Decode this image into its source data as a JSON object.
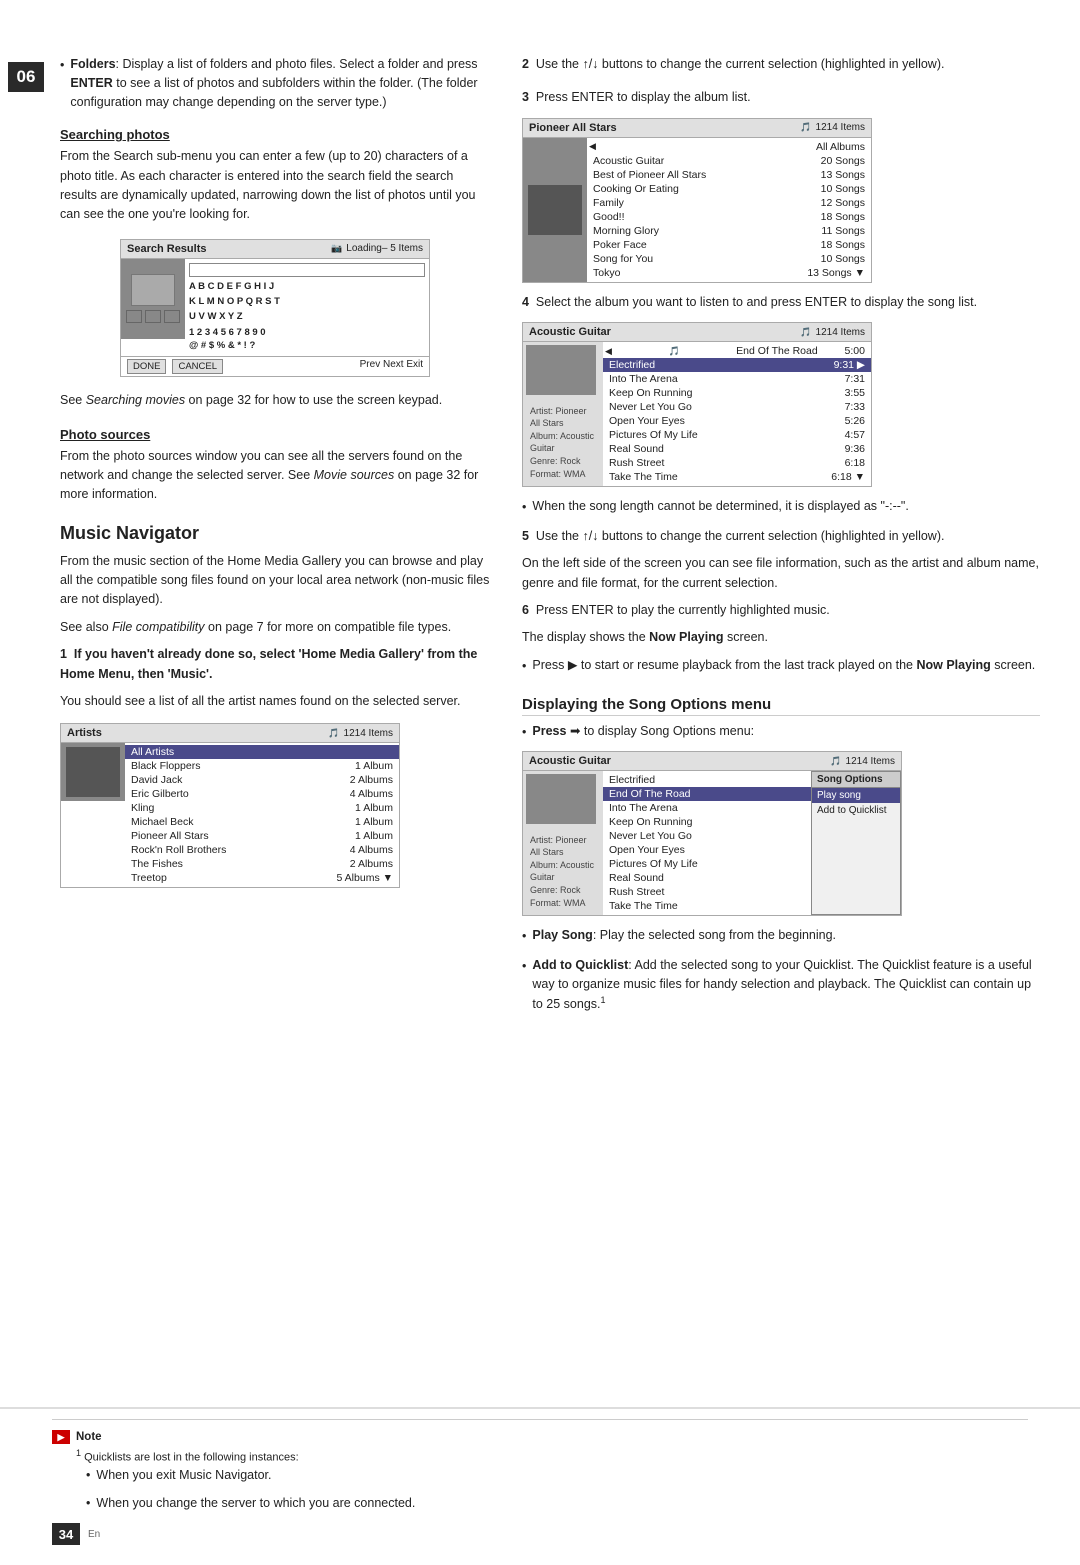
{
  "page": {
    "chapter": "06",
    "page_number": "34",
    "lang": "En"
  },
  "left_column": {
    "bullet_folders": {
      "label": "Folders",
      "text": ": Display a list of folders and photo files. Select a folder and press ",
      "enter_label": "ENTER",
      "text2": " to see a list of photos and subfolders within the folder. (The folder configuration may change depending on the server type.)"
    },
    "searching_photos": {
      "heading": "Searching photos",
      "body": "From the Search sub-menu you can enter a few (up to 20) characters of a photo title. As each character is entered into the search field the search results are dynamically updated, narrowing down the list of photos until you can see the one you're looking for."
    },
    "search_screenshot": {
      "header": "Search Results",
      "badge": "Loading– 5 Items",
      "keypad_row1": "A B C D E F G H I J",
      "keypad_row2": "K L M N O P Q R S T",
      "keypad_row3": "U V W X Y Z",
      "keypad_row4": "1 2 3 4 5 6 7 8 9 0",
      "keypad_row5": "@ # $ % & * ! ?",
      "footer_done": "DONE",
      "footer_cancel": "CANCEL",
      "footer_right": "Prev Next Exit"
    },
    "see_searching": "See ",
    "see_searching_italic": "Searching movies",
    "see_searching2": " on page 32 for how to use the screen keypad.",
    "photo_sources": {
      "heading": "Photo sources",
      "body": "From the photo sources window you can see all the servers found on the network and change the selected server. See ",
      "italic": "Movie sources",
      "body2": " on page 32 for more information."
    }
  },
  "music_navigator": {
    "title": "Music Navigator",
    "intro": "From the music section of the Home Media Gallery you can browse and play all the compatible song files found on your local area network (non-music files are not displayed).",
    "see_also_pre": "See also ",
    "see_also_italic": "File compatibility",
    "see_also_post": " on page 7 for more on compatible file types.",
    "step1": {
      "num": "1",
      "bold": "If you haven't already done so, select 'Home Media Gallery' from the Home Menu, then 'Music'.",
      "body": "You should see a list of all the artist names found on the selected server."
    },
    "artists_screenshot": {
      "header": "Artists",
      "badge": "1214 Items",
      "all_artists_label": "All Artists",
      "items": [
        {
          "name": "Black Floppers",
          "count": "1 Album"
        },
        {
          "name": "David Jack",
          "count": "2 Albums"
        },
        {
          "name": "Eric Gilberto",
          "count": "4 Albums"
        },
        {
          "name": "Kling",
          "count": "1 Album"
        },
        {
          "name": "Michael Beck",
          "count": "1 Album"
        },
        {
          "name": "Pioneer All Stars",
          "count": "1 Album"
        },
        {
          "name": "Rock'n Roll Brothers",
          "count": "4 Albums"
        },
        {
          "name": "The Fishes",
          "count": "2 Albums"
        },
        {
          "name": "Treetop",
          "count": "5 Albums"
        }
      ],
      "scroll_indicator": "▼"
    }
  },
  "right_column": {
    "step2": {
      "num": "2",
      "text": "Use the ↑/↓ buttons to change the current selection (highlighted in yellow)."
    },
    "step3": {
      "num": "3",
      "text": "Press ENTER to display the album list."
    },
    "pioneer_screenshot": {
      "header": "Pioneer All Stars",
      "badge": "1214 Items",
      "all_albums_label": "All Albums",
      "items": [
        {
          "name": "Acoustic Guitar",
          "count": "20 Songs"
        },
        {
          "name": "Best of Pioneer All Stars",
          "count": "13 Songs"
        },
        {
          "name": "Cooking Or Eating",
          "count": "10 Songs"
        },
        {
          "name": "Family",
          "count": "12 Songs"
        },
        {
          "name": "Good!!",
          "count": "18 Songs"
        },
        {
          "name": "Morning Glory",
          "count": "11 Songs"
        },
        {
          "name": "Poker Face",
          "count": "18 Songs"
        },
        {
          "name": "Song for You",
          "count": "10 Songs"
        },
        {
          "name": "Tokyo",
          "count": "13 Songs"
        }
      ],
      "scroll_indicator": "▼"
    },
    "step4": {
      "num": "4",
      "text": "Select the album you want to listen to and press ENTER to display the song list."
    },
    "acoustic_screenshot": {
      "header": "Acoustic Guitar",
      "badge": "1214 Items",
      "items": [
        {
          "name": "End Of The Road",
          "duration": "5:00",
          "selected": true
        },
        {
          "name": "Electrified",
          "duration": "9:31",
          "arrow": "▶"
        },
        {
          "name": "Into The Arena",
          "duration": "7:31"
        },
        {
          "name": "Keep On Running",
          "duration": "3:55"
        },
        {
          "name": "Never Let You Go",
          "duration": "7:33"
        },
        {
          "name": "Open Your Eyes",
          "duration": "5:26"
        },
        {
          "name": "Pictures Of My Life",
          "duration": "4:57"
        },
        {
          "name": "Real Sound",
          "duration": "9:36"
        },
        {
          "name": "Rush Street",
          "duration": "6:18"
        },
        {
          "name": "Take The Time",
          "duration": "6:18"
        }
      ],
      "scroll_indicator": "▼",
      "artist_info": "Artist: Pioneer All Stars\nAlbum: Acoustic Guitar\nGenre: Rock\nFormat: WMA"
    },
    "undetermined_note": "When the song length cannot be determined, it is displayed as \"-:--\".",
    "step5": {
      "num": "5",
      "text": "Use the ↑/↓ buttons to change the current selection (highlighted in yellow).",
      "body": "On the left side of the screen you can see file information, such as the artist and album name, genre and file format, for the current selection."
    },
    "step6": {
      "num": "6",
      "text": "Press ENTER to play the currently highlighted music.",
      "body_pre": "The display shows the ",
      "body_bold": "Now Playing",
      "body_post": " screen."
    },
    "press_bullet": {
      "text_pre": "Press ▶ to start or resume playback from the last track played on the ",
      "bold": "Now Playing",
      "text_post": " screen."
    },
    "displaying_song_options": {
      "title": "Displaying the Song Options menu",
      "bullet_pre": "Press ➡ to display Song Options menu:"
    },
    "song_options_screenshot": {
      "header": "Acoustic Guitar",
      "badge": "1214 Items",
      "items": [
        {
          "name": "Electrified"
        },
        {
          "name": "End Of The Road",
          "selected": true
        },
        {
          "name": "Into The Arena"
        },
        {
          "name": "Keep On Running"
        },
        {
          "name": "Never Let You Go"
        },
        {
          "name": "Open Your Eyes"
        },
        {
          "name": "Pictures Of My Life"
        },
        {
          "name": "Real Sound"
        },
        {
          "name": "Rush Street"
        },
        {
          "name": "Take The Time"
        }
      ],
      "options_popup": [
        {
          "label": "Song Options",
          "is_header": true
        },
        {
          "label": "Play song",
          "selected": true
        },
        {
          "label": "Add to Quicklist"
        }
      ],
      "artist_info": "Artist: Pioneer All Stars\nAlbum: Acoustic Guitar\nGenre: Rock\nFormat: WMA"
    },
    "play_song_bullet": {
      "label": "Play Song",
      "text": ": Play the selected song from the beginning."
    },
    "add_quicklist_bullet": {
      "label": "Add to Quicklist",
      "text": ": Add the selected song to your Quicklist. The Quicklist feature is a useful way to organize music files for handy selection and playback. The Quicklist can contain up to 25 songs."
    },
    "superscript": "1"
  },
  "note_section": {
    "label": "Note",
    "footnote_num": "1",
    "footnote_text": "Quicklists are lost in the following instances:",
    "bullets": [
      "When you exit Music Navigator.",
      "When you change the server to which you are connected."
    ]
  }
}
